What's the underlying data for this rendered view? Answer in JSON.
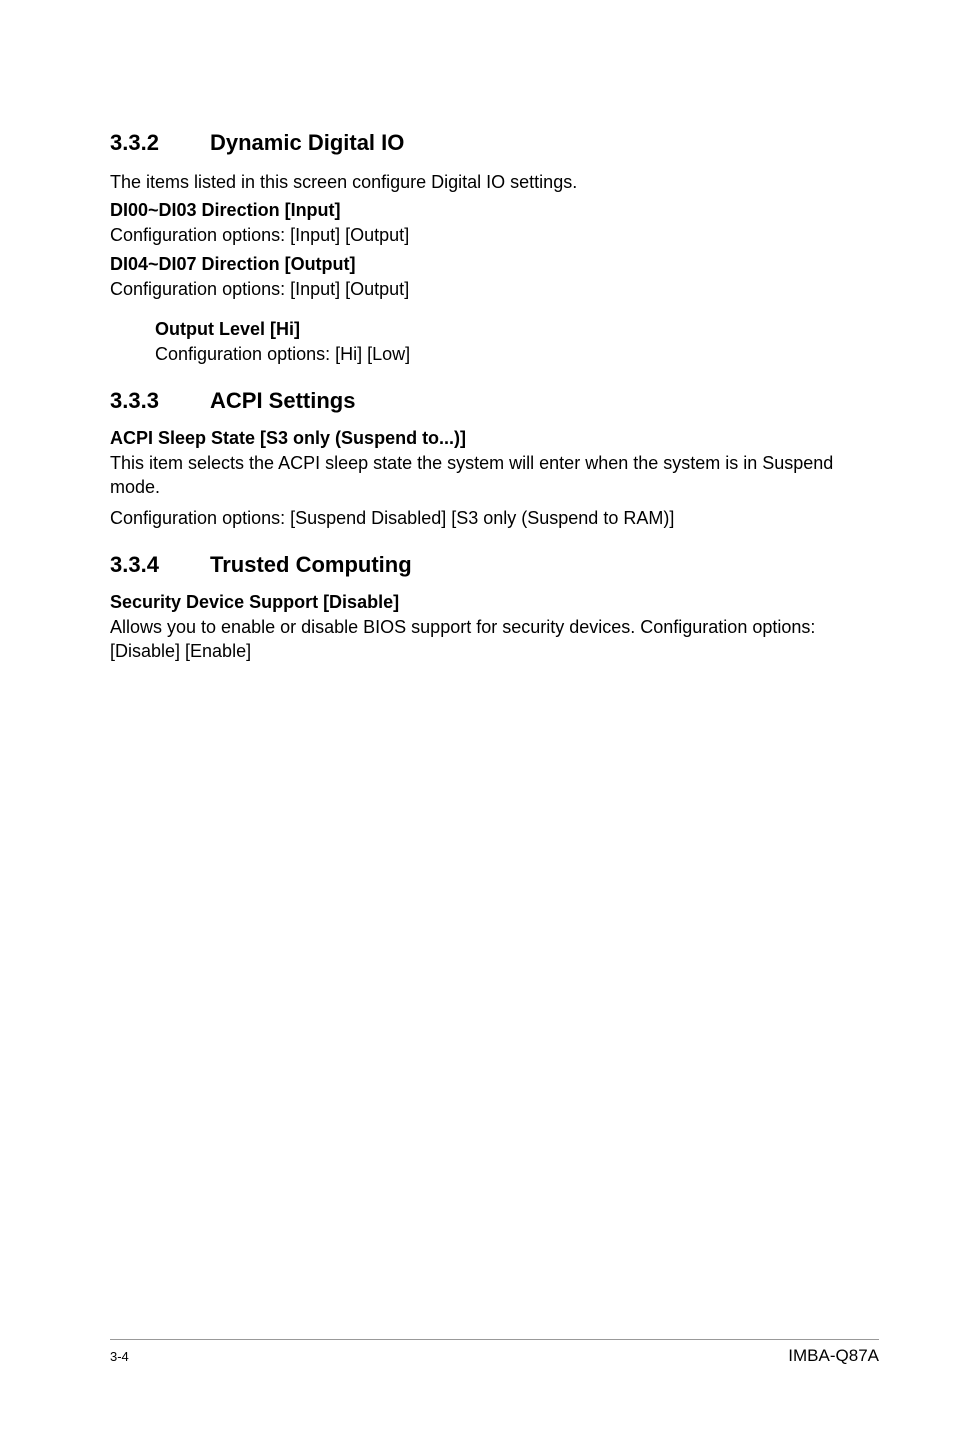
{
  "sections": {
    "s332": {
      "number": "3.3.2",
      "title": "Dynamic Digital IO",
      "intro": "The items listed in this screen configure Digital IO settings.",
      "item1_label": "DI00~DI03 Direction [Input]",
      "item1_text": "Configuration options: [Input] [Output]",
      "item2_label": "DI04~DI07 Direction [Output]",
      "item2_text": "Configuration options: [Input] [Output]",
      "sub_label": "Output Level [Hi]",
      "sub_text": "Configuration options: [Hi] [Low]"
    },
    "s333": {
      "number": "3.3.3",
      "title": "ACPI Settings",
      "item1_label": "ACPI Sleep State [S3 only (Suspend to...)]",
      "item1_text1": "This item selects the ACPI sleep state the system will enter when the system is in Suspend mode.",
      "item1_text2": "Configuration options: [Suspend Disabled] [S3 only (Suspend to RAM)]"
    },
    "s334": {
      "number": "3.3.4",
      "title": "Trusted Computing",
      "item1_label": "Security Device Support [Disable]",
      "item1_text": "Allows you to enable or disable BIOS support for security devices. Configuration options: [Disable] [Enable]"
    }
  },
  "footer": {
    "page": "3-4",
    "product": "IMBA-Q87A"
  }
}
